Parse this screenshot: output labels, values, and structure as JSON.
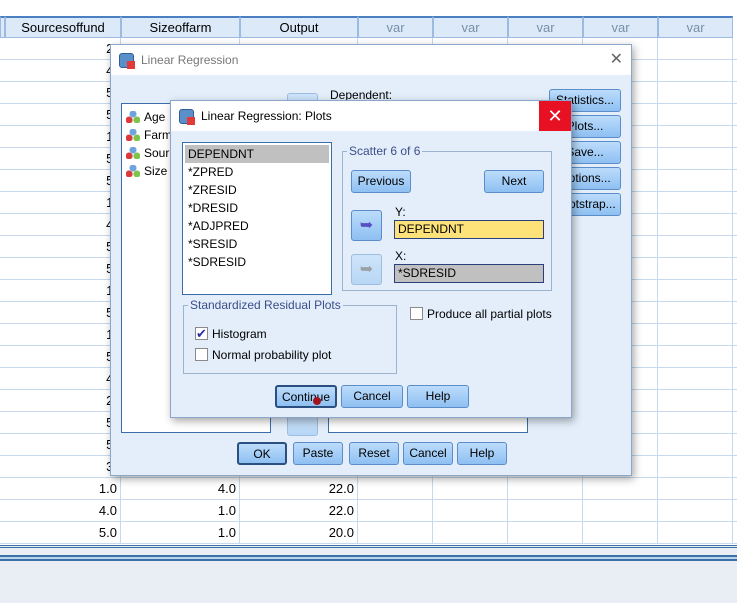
{
  "grid": {
    "columns": [
      "Sourcesoffund",
      "Sizeoffarm",
      "Output",
      "var",
      "var",
      "var",
      "var",
      "var"
    ],
    "rows": [
      [
        "2.",
        "",
        ""
      ],
      [
        "4.",
        "",
        ""
      ],
      [
        "5.",
        "",
        ""
      ],
      [
        "5.",
        "",
        ""
      ],
      [
        "1.",
        "",
        ""
      ],
      [
        "5.",
        "",
        ""
      ],
      [
        "5.",
        "",
        ""
      ],
      [
        "1.",
        "",
        ""
      ],
      [
        "4.",
        "",
        ""
      ],
      [
        "5.",
        "",
        ""
      ],
      [
        "5.",
        "",
        ""
      ],
      [
        "1.",
        "",
        ""
      ],
      [
        "5.",
        "",
        ""
      ],
      [
        "1.",
        "",
        ""
      ],
      [
        "5.",
        "",
        ""
      ],
      [
        "4.",
        "",
        ""
      ],
      [
        "2.",
        "",
        ""
      ],
      [
        "5.",
        "",
        ""
      ],
      [
        "5.",
        "",
        ""
      ],
      [
        "3.",
        "",
        ""
      ],
      [
        "1.0",
        "4.0",
        "22.0"
      ],
      [
        "4.0",
        "1.0",
        "22.0"
      ],
      [
        "5.0",
        "1.0",
        "20.0"
      ]
    ]
  },
  "main_dialog": {
    "title": "Linear Regression",
    "dependent_label": "Dependent:",
    "variables": [
      "Age",
      "Farm",
      "Sour",
      "Size"
    ],
    "side_buttons": [
      "Statistics...",
      "Plots...",
      "Save...",
      "Options...",
      "Bootstrap..."
    ],
    "buttons": [
      "OK",
      "Paste",
      "Reset",
      "Cancel",
      "Help"
    ]
  },
  "plots_dialog": {
    "title": "Linear Regression: Plots",
    "source_list": [
      "DEPENDNT",
      "*ZPRED",
      "*ZRESID",
      "*DRESID",
      "*ADJPRED",
      "*SRESID",
      "*SDRESID"
    ],
    "selected_source": "DEPENDNT",
    "scatter_legend": "Scatter 6 of 6",
    "previous": "Previous",
    "next": "Next",
    "y_label": "Y:",
    "y_value": "DEPENDNT",
    "x_label": "X:",
    "x_value": "*SDRESID",
    "residual_legend": "Standardized Residual Plots",
    "histogram": {
      "label": "Histogram",
      "checked": true
    },
    "normal_plot": {
      "label": "Normal probability plot",
      "checked": false
    },
    "partial_plots": {
      "label": "Produce all partial plots",
      "checked": false
    },
    "buttons": [
      "Continue",
      "Cancel",
      "Help"
    ],
    "close_color": "#e81123"
  }
}
